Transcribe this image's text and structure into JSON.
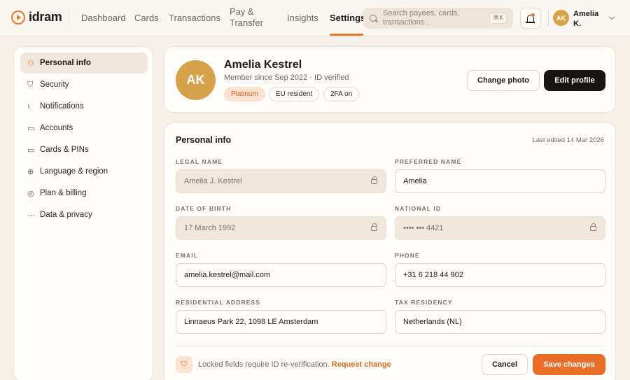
{
  "brand": {
    "name": "idram",
    "accent": "#e8782d"
  },
  "nav": {
    "items": [
      {
        "label": "Dashboard"
      },
      {
        "label": "Cards"
      },
      {
        "label": "Transactions"
      },
      {
        "label": "Pay & Transfer"
      },
      {
        "label": "Insights"
      },
      {
        "label": "Settings",
        "active": true
      }
    ]
  },
  "search": {
    "placeholder": "Search payees, cards, transactions…",
    "shortcut": "⌘K"
  },
  "user": {
    "initials": "AK",
    "name": "Amelia K."
  },
  "sidebar": {
    "items": [
      {
        "label": "Personal info",
        "icon": "person-icon",
        "active": true
      },
      {
        "label": "Security",
        "icon": "shield-icon"
      },
      {
        "label": "Notifications",
        "icon": "bell-icon"
      },
      {
        "label": "Accounts",
        "icon": "account-icon"
      },
      {
        "label": "Cards & PINs",
        "icon": "card-icon"
      },
      {
        "label": "Language & region",
        "icon": "globe-icon"
      },
      {
        "label": "Plan & billing",
        "icon": "billing-icon"
      },
      {
        "label": "Data & privacy",
        "icon": "more-icon"
      }
    ]
  },
  "profile": {
    "initials": "AK",
    "name": "Amelia Kestrel",
    "subtitle": "Member since Sep 2022 · ID verified",
    "badges": [
      "Platinum",
      "EU resident",
      "2FA on"
    ],
    "change_photo_label": "Change photo",
    "edit_profile_label": "Edit profile"
  },
  "personal_info": {
    "title": "Personal info",
    "last_edited": "Last edited 14 Mar 2026",
    "fields": {
      "legal_name": {
        "label": "LEGAL NAME",
        "value": "Amelia J. Kestrel",
        "locked": true
      },
      "preferred_name": {
        "label": "PREFERRED NAME",
        "value": "Amelia"
      },
      "date_of_birth": {
        "label": "DATE OF BIRTH",
        "value": "17 March 1992",
        "locked": true
      },
      "national_id": {
        "label": "NATIONAL ID",
        "value": "•••• ••• 4421",
        "locked": true
      },
      "email": {
        "label": "EMAIL",
        "value": "amelia.kestrel@mail.com"
      },
      "phone": {
        "label": "PHONE",
        "value": "+31 6 218 44 902"
      },
      "address": {
        "label": "RESIDENTIAL ADDRESS",
        "value": "Linnaeus Park 22, 1098 LE Amsterdam"
      },
      "tax_residency": {
        "label": "TAX RESIDENCY",
        "value": "Netherlands (NL)"
      }
    },
    "footer_note": "Locked fields require ID re-verification.",
    "footer_link": "Request change",
    "cancel_label": "Cancel",
    "save_label": "Save changes"
  }
}
